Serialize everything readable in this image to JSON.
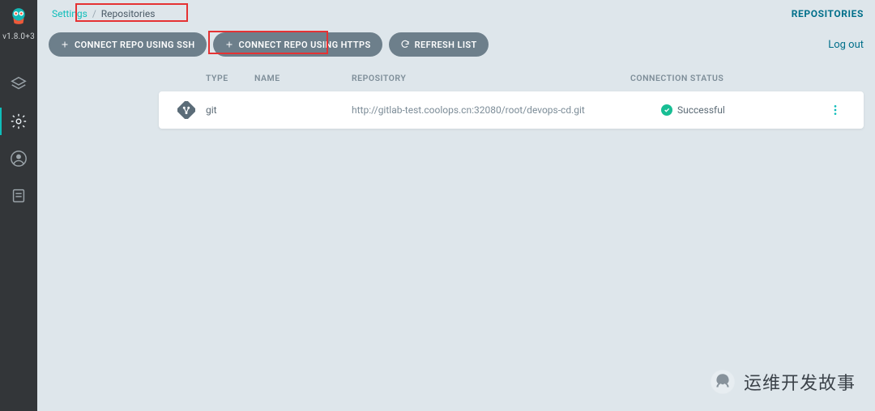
{
  "app": {
    "version": "v1.8.0+3"
  },
  "breadcrumbs": {
    "parent": "Settings",
    "current": "Repositories"
  },
  "header": {
    "repos_link": "REPOSITORIES",
    "logout": "Log out"
  },
  "actions": {
    "connect_ssh": "CONNECT REPO USING SSH",
    "connect_https": "CONNECT REPO USING HTTPS",
    "refresh": "REFRESH LIST"
  },
  "table": {
    "headers": {
      "type": "TYPE",
      "name": "NAME",
      "repository": "REPOSITORY",
      "status": "CONNECTION STATUS"
    },
    "rows": [
      {
        "type": "git",
        "name": "",
        "repository": "http://gitlab-test.coolops.cn:32080/root/devops-cd.git",
        "status": "Successful"
      }
    ]
  },
  "watermark": {
    "text": "运维开发故事"
  },
  "colors": {
    "accent": "#0fbdba",
    "pill": "#6d7f8b",
    "success": "#18be94",
    "link": "#006f8a"
  }
}
